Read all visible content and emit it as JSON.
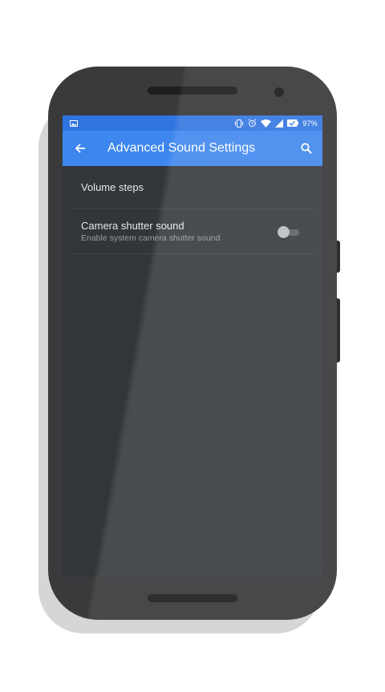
{
  "status_bar": {
    "battery_percent": "97%",
    "icons": [
      "image-notification-icon",
      "vibrate-icon",
      "alarm-icon",
      "wifi-icon",
      "signal-icon",
      "battery-icon"
    ]
  },
  "app_bar": {
    "title": "Advanced Sound Settings",
    "back_icon": "arrow-back-icon",
    "search_icon": "search-icon",
    "color": "#3d86ee",
    "status_color": "#2f74e0"
  },
  "settings": {
    "volume_steps": {
      "title": "Volume steps"
    },
    "camera_shutter": {
      "title": "Camera shutter sound",
      "subtitle": "Enable system camera shutter sound",
      "enabled": false
    }
  },
  "theme": {
    "screen_background": "#32363b",
    "phone_body": "#3a3a3c"
  }
}
